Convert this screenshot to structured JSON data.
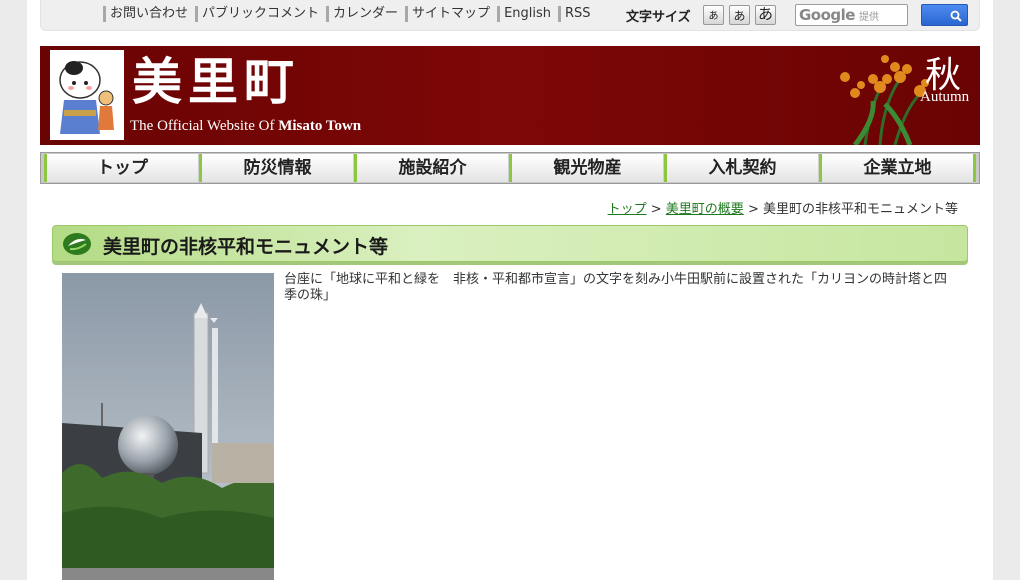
{
  "utility": {
    "links": [
      "お問い合わせ",
      "パブリックコメント",
      "カレンダー",
      "サイトマップ",
      "English",
      "RSS"
    ],
    "font_size_label": "文字サイズ",
    "font_size_buttons": [
      "あ",
      "あ",
      "あ"
    ],
    "search_brand": "Google",
    "search_placeholder": "提供"
  },
  "banner": {
    "title": "美里町",
    "subtitle_prefix": "The Official Website Of ",
    "subtitle_strong": "Misato Town",
    "season_kanji": "秋",
    "season_en": "Autumn"
  },
  "nav": [
    "トップ",
    "防災情報",
    "施設紹介",
    "観光物産",
    "入札契約",
    "企業立地"
  ],
  "breadcrumb": {
    "items": [
      "トップ",
      "美里町の概要"
    ],
    "separator": ">",
    "current": "美里町の非核平和モニュメント等"
  },
  "heading": "美里町の非核平和モニュメント等",
  "caption": "台座に「地球に平和と緑を　非核・平和都市宣言」の文字を刻み小牛田駅前に設置された「カリヨンの時計塔と四季の珠」",
  "colors": {
    "banner": "#6a0303",
    "nav_accent": "#8dc63f",
    "heading_bg": "#c6e69f",
    "link": "#1f7a1f"
  }
}
